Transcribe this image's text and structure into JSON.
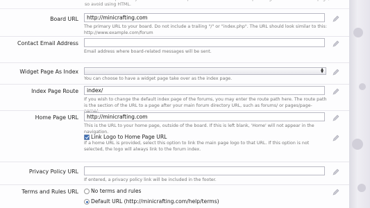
{
  "top_hint": "Enter a description for your board. This will be placed inside the meta description tag for the forum home page, so avoid using HTML.",
  "fields": {
    "board_url": {
      "label": "Board URL",
      "value": "http://minicrafting.com",
      "hint": "The primary URL to your board. Do not include a trailing \"/\" or \"index.php\". The URL should look similar to this: http://www.example.com/forum"
    },
    "contact_email": {
      "label": "Contact Email Address",
      "value": "",
      "hint": "Email address where board-related messages will be sent."
    },
    "widget_page": {
      "label": "Widget Page As Index",
      "value": "",
      "hint": "You can choose to have a widget page take over as the index page."
    },
    "index_route": {
      "label": "Index Page Route",
      "value": "index/",
      "hint": "If you wish to change the default index page of the forums, you may enter the route path here. The route path is the section of the URL to a page after your main forum directory URL, such as forums/ or pages/page-name/."
    },
    "home_url": {
      "label": "Home Page URL",
      "value": "http://minicrafting.com",
      "hint": "This is the URL to your home page, outside of the board. If this is left blank, 'Home' will not appear in the navigation."
    },
    "link_logo": {
      "label": "Link Logo to Home Page URL",
      "checked": true,
      "hint": "If a home URL is provided, select this option to link the main page logo to that URL. If this option is not selected, the logo will always link to the forum index."
    },
    "privacy_url": {
      "label": "Privacy Policy URL",
      "value": "",
      "hint": "If entered, a privacy policy link will be included in the footer."
    },
    "terms_url": {
      "label": "Terms and Rules URL",
      "options": [
        "No terms and rules",
        "Default URL (http://minicrafting.com/help/terms)"
      ],
      "selected_index": 1
    }
  },
  "icons": {
    "edit": "pencil-edit-icon"
  },
  "colors": {
    "accent": "#3d6eb4",
    "border": "#b9b9c3"
  }
}
